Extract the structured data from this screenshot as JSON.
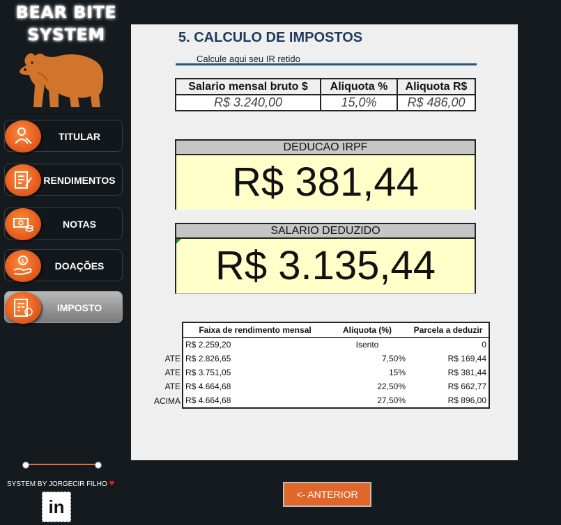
{
  "brand": {
    "line1": "BEAR BITE",
    "line2": "SYSTEM"
  },
  "nav": [
    {
      "label": "TITULAR",
      "icon": "user-contract-icon"
    },
    {
      "label": "RENDIMENTOS",
      "icon": "document-edit-icon"
    },
    {
      "label": "NOTAS",
      "icon": "money-coins-icon"
    },
    {
      "label": "DOAÇÕES",
      "icon": "hand-coin-icon"
    },
    {
      "label": "IMPOSTO",
      "icon": "calculator-icon",
      "active": true
    }
  ],
  "credit": {
    "text": "SYSTEM BY JORGECIR FILHO",
    "linkedin": "in"
  },
  "page": {
    "title": "5. CALCULO DE IMPOSTOS",
    "subtitle": "Calcule aqui seu IR retido"
  },
  "summary": {
    "headers": [
      "Salario mensal bruto $",
      "Aliquota %",
      "Aliquota R$"
    ],
    "values": [
      "R$ 3.240,00",
      "15,0%",
      "R$ 486,00"
    ]
  },
  "deducao": {
    "label": "DEDUCAO IRPF",
    "value": "R$ 381,44"
  },
  "salario": {
    "label": "SALARIO DEDUZIDO",
    "value": "R$ 3.135,44"
  },
  "faixas": {
    "headers": [
      "Faixa de rendimento mensal",
      "Alíquota (%)",
      "Parcela a deduzir"
    ],
    "rows": [
      {
        "prefix": "",
        "faixa": "R$ 2.259,20",
        "aliquota": "Isento",
        "parcela": "0"
      },
      {
        "prefix": "ATE",
        "faixa": "R$ 2.826,65",
        "aliquota": "7,50%",
        "parcela": "R$ 169,44"
      },
      {
        "prefix": "ATE",
        "faixa": "R$ 3.751,05",
        "aliquota": "15%",
        "parcela": "R$ 381,44"
      },
      {
        "prefix": "ATE",
        "faixa": "R$ 4.664,68",
        "aliquota": "22,50%",
        "parcela": "R$ 662,77"
      },
      {
        "prefix": "ACIMA",
        "faixa": "R$ 4.664,68",
        "aliquota": "27,50%",
        "parcela": "R$ 896,00"
      }
    ]
  },
  "buttons": {
    "prev": "<- ANTERIOR"
  },
  "colors": {
    "accent": "#e0662a",
    "title": "#1f3a5a",
    "highlight": "#ffffc9"
  }
}
